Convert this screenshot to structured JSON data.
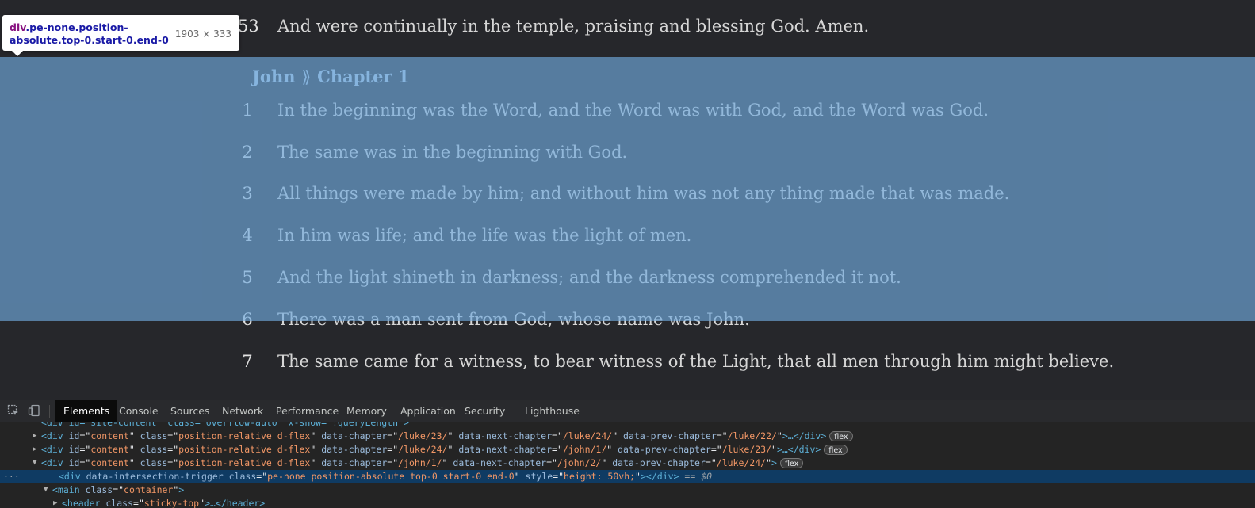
{
  "page": {
    "prev_verse": {
      "num": "53",
      "text": "And were continually in the temple, praising and blessing God. Amen."
    },
    "chapter_head": {
      "book": "John",
      "separator": "⟫",
      "chapter": "Chapter 1"
    },
    "verses": [
      {
        "num": "1",
        "text": "In the beginning was the Word, and the Word was with God, and the Word was God."
      },
      {
        "num": "2",
        "text": "The same was in the beginning with God."
      },
      {
        "num": "3",
        "text": "All things were made by him; and without him was not any thing made that was made."
      },
      {
        "num": "4",
        "text": "In him was life; and the life was the light of men."
      },
      {
        "num": "5",
        "text": "And the light shineth in darkness; and the darkness comprehended it not."
      },
      {
        "num": "6",
        "text": "There was a man sent from God, whose name was John."
      },
      {
        "num": "7",
        "text": "The same came for a witness, to bear witness of the Light, that all men through him might believe."
      }
    ]
  },
  "tooltip": {
    "tag": "div",
    "classes": ".pe-none.position-absolute.top-0.start-0.end-0",
    "dims": "1903 × 333"
  },
  "devtools": {
    "tabs": [
      "Elements",
      "Console",
      "Sources",
      "Network",
      "Performance",
      "Memory",
      "Application",
      "Security",
      "Lighthouse"
    ],
    "active_tab": "Elements",
    "dom_lines": [
      {
        "partial": "<div id=\"site-content\" class=\"overflow-auto\" x-show=\"!queryLength\">"
      },
      {
        "tag": "div",
        "attrs": [
          {
            "name": "id",
            "value": "content"
          },
          {
            "name": "class",
            "value": "position-relative d-flex"
          },
          {
            "name": "data-chapter",
            "value": "/luke/23/"
          },
          {
            "name": "data-next-chapter",
            "value": "/luke/24/"
          },
          {
            "name": "data-prev-chapter",
            "value": "/luke/22/"
          }
        ],
        "suffix": "…</div>",
        "badge": "flex"
      },
      {
        "tag": "div",
        "attrs": [
          {
            "name": "id",
            "value": "content"
          },
          {
            "name": "class",
            "value": "position-relative d-flex"
          },
          {
            "name": "data-chapter",
            "value": "/luke/24/"
          },
          {
            "name": "data-next-chapter",
            "value": "/john/1/"
          },
          {
            "name": "data-prev-chapter",
            "value": "/luke/23/"
          }
        ],
        "suffix": "…</div>",
        "badge": "flex"
      },
      {
        "tag": "div",
        "attrs": [
          {
            "name": "id",
            "value": "content"
          },
          {
            "name": "class",
            "value": "position-relative d-flex"
          },
          {
            "name": "data-chapter",
            "value": "/john/1/"
          },
          {
            "name": "data-next-chapter",
            "value": "/john/2/"
          },
          {
            "name": "data-prev-chapter",
            "value": "/luke/24/"
          }
        ],
        "suffix": "",
        "badge": "flex"
      },
      {
        "tag": "div",
        "attrs": [
          {
            "name": "data-intersection-trigger",
            "value": null
          },
          {
            "name": "class",
            "value": "pe-none position-absolute top-0 start-0 end-0"
          },
          {
            "name": "style",
            "value": "height: 50vh;"
          }
        ],
        "suffix": "</div>",
        "tail": " == $0"
      },
      {
        "tag": "main",
        "attrs": [
          {
            "name": "class",
            "value": "container"
          }
        ],
        "suffix": ""
      },
      {
        "tag": "header",
        "attrs": [
          {
            "name": "class",
            "value": "sticky-top"
          }
        ],
        "suffix": "…</header>"
      }
    ],
    "ellipsis": "···"
  }
}
